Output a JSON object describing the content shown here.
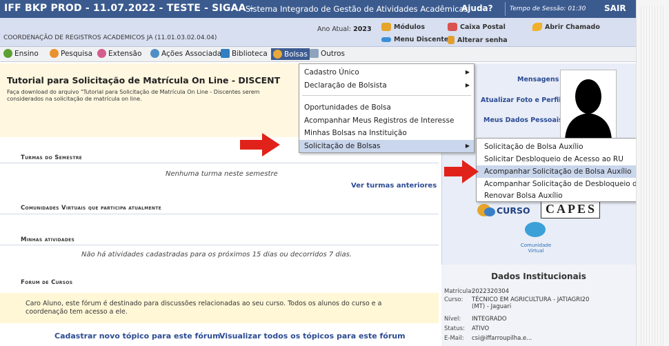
{
  "header": {
    "system_title": "IFF BKP PROD - 11.07.2022 - TESTE - SIGAA -",
    "system_name": "Sistema Integrado de Gestão de Atividades Acadêmicas",
    "help": "Ajuda?",
    "session": "Tempo de Sessão: 01:30",
    "logout": "SAIR"
  },
  "infobar": {
    "coordination": "COORDENAÇÃO DE REGISTROS ACADEMICOS JA (11.01.03.02.04.04)",
    "year_label": "Ano Atual:",
    "year_value": "2023",
    "modulos": "Módulos",
    "caixa_postal": "Caixa Postal",
    "abrir_chamado": "Abrir Chamado",
    "menu_discente": "Menu Discente",
    "alterar_senha": "Alterar senha"
  },
  "menu": {
    "ensino": "Ensino",
    "pesquisa": "Pesquisa",
    "extensao": "Extensão",
    "acoes": "Ações Associadas",
    "biblioteca": "Biblioteca",
    "bolsas": "Bolsas",
    "outros": "Outros"
  },
  "dropdown": {
    "items": [
      "Cadastro Único",
      "Declaração de Bolsista",
      "Oportunidades de Bolsa",
      "Acompanhar Meus Registros de Interesse",
      "Minhas Bolsas na Instituição",
      "Solicitação de Bolsas"
    ]
  },
  "submenu": {
    "items": [
      "Solicitação de Bolsa Auxílio",
      "Solicitar Desbloqueio de Acesso ao RU",
      "Acompanhar Solicitação de Bolsa Auxílio",
      "Acompanhar Solicitação de Desbloqueio do RU",
      "Renovar Bolsa Auxílio"
    ]
  },
  "tutorial": {
    "title": "Tutorial para Solicitação de Matrícula On Line - DISCENT",
    "desc": "Faça download do arquivo \"Tutorial para Solicitação de Matrícula On Line - Discentes serem considerados  na solicitação de matrícula on line."
  },
  "turmas": {
    "title": "Turmas do Semestre",
    "empty": "Nenhuma turma neste semestre",
    "link": "Ver turmas anteriores"
  },
  "comunidades": {
    "title": "Comunidades Virtuais que participa atualmente"
  },
  "atividades": {
    "title": "Minhas atividades",
    "empty": "Não há atividades cadastradas para os próximos 15 dias ou decorridos 7 dias."
  },
  "forum": {
    "title": "Forum de Cursos",
    "text": "Caro Aluno, este fórum é destinado para discussões relacionadas ao seu curso. Todos os alunos do curso e a coordenação tem acesso a ele.",
    "link_new": "Cadastrar novo tópico para este fórum",
    "link_all": "Visualizar todos os tópicos para este fórum"
  },
  "sidebar": {
    "mensagens": "Mensagens",
    "atualizar_foto": "Atualizar Foto e Perfil",
    "meus_dados": "Meus Dados Pessoais",
    "curso_logo": "CURSO",
    "capes_logo": "CAPES",
    "comunidade_virtual": "Comunidade Virtual"
  },
  "dados": {
    "title": "Dados Institucionais",
    "rows": [
      {
        "k": "Matrícula:",
        "v": "2022320304"
      },
      {
        "k": "Curso:",
        "v": "TÉCNICO EM AGRICULTURA - JATIAGRI20 (MT) - Jaguari"
      },
      {
        "k": "Nível:",
        "v": "INTEGRADO"
      },
      {
        "k": "Status:",
        "v": "ATIVO"
      },
      {
        "k": "E-Mail:",
        "v": "csi@iffarroupilha.e..."
      }
    ]
  },
  "colors": {
    "header_blue": "#3b5b8f",
    "link_blue": "#2c4b93",
    "highlight": "#c9d6ec",
    "arrow_red": "#e0221a"
  }
}
